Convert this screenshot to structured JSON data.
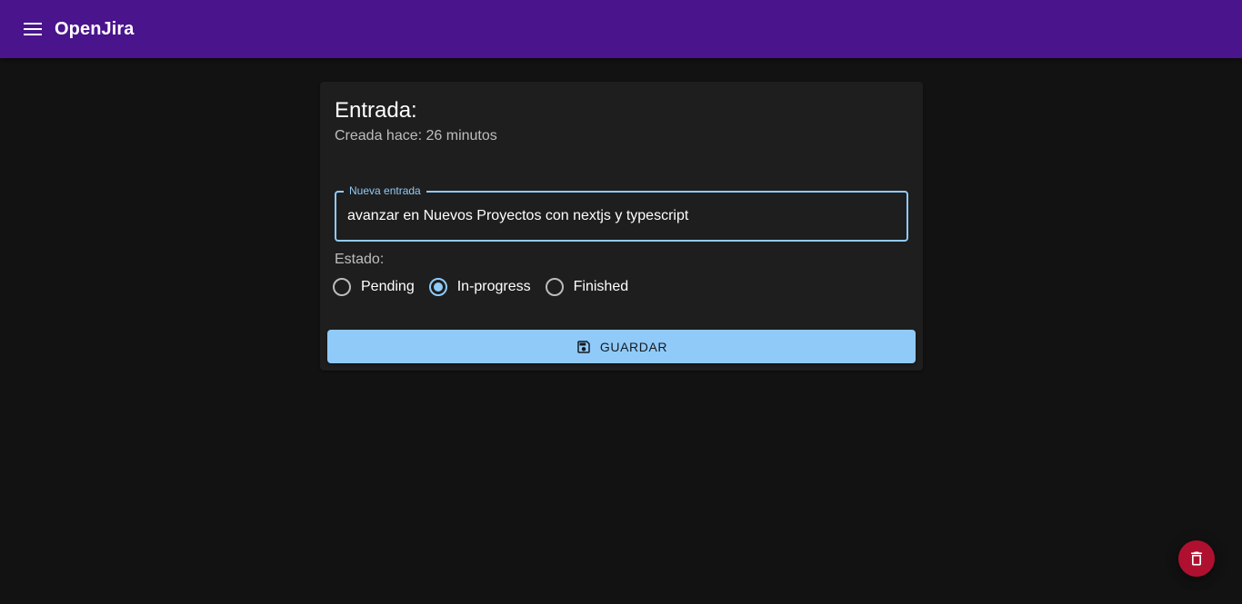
{
  "appbar": {
    "title": "OpenJira",
    "menu_icon": "menu-icon",
    "color": "#4a148c"
  },
  "entry": {
    "title": "Entrada:",
    "subtitle": "Creada hace: 26 minutos",
    "field": {
      "label": "Nueva entrada",
      "value": "avanzar en Nuevos Proyectos con nextjs y typescript"
    },
    "status": {
      "label": "Estado:",
      "options": [
        "Pending",
        "In-progress",
        "Finished"
      ],
      "selected": "In-progress"
    },
    "save_button": {
      "label": "GUARDAR",
      "icon": "save-icon"
    }
  },
  "fab": {
    "icon": "delete-icon",
    "color": "#b0102f"
  },
  "colors": {
    "background": "#121212",
    "card": "#1e1e1e",
    "accent": "#90caf9"
  }
}
